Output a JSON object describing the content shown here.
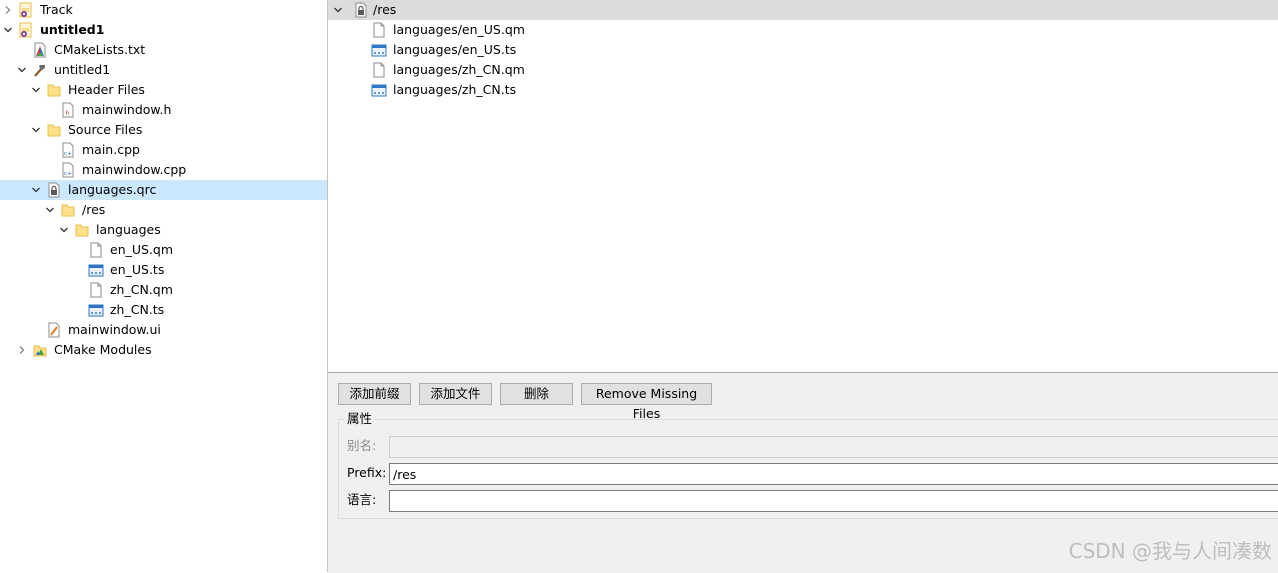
{
  "project_tree": [
    {
      "label": "Track",
      "icon": "qt-project-icon",
      "expand": "collapsed",
      "depth": 0,
      "bold": false
    },
    {
      "label": "untitled1",
      "icon": "qt-project-icon",
      "expand": "expanded",
      "depth": 0,
      "bold": true
    },
    {
      "label": "CMakeLists.txt",
      "icon": "cmake-file-icon",
      "expand": "none",
      "depth": 1,
      "bold": false
    },
    {
      "label": "untitled1",
      "icon": "build-target-icon",
      "expand": "expanded",
      "depth": 1,
      "bold": false
    },
    {
      "label": "Header Files",
      "icon": "folder-icon",
      "expand": "expanded",
      "depth": 2,
      "bold": false
    },
    {
      "label": "mainwindow.h",
      "icon": "header-file-icon",
      "expand": "none",
      "depth": 3,
      "bold": false
    },
    {
      "label": "Source Files",
      "icon": "folder-icon",
      "expand": "expanded",
      "depth": 2,
      "bold": false
    },
    {
      "label": "main.cpp",
      "icon": "cpp-file-icon",
      "expand": "none",
      "depth": 3,
      "bold": false
    },
    {
      "label": "mainwindow.cpp",
      "icon": "cpp-file-icon",
      "expand": "none",
      "depth": 3,
      "bold": false
    },
    {
      "label": "languages.qrc",
      "icon": "qrc-file-icon",
      "expand": "expanded",
      "depth": 2,
      "bold": false,
      "selected": true
    },
    {
      "label": "/res",
      "icon": "folder-icon",
      "expand": "expanded",
      "depth": 3,
      "bold": false
    },
    {
      "label": "languages",
      "icon": "folder-icon",
      "expand": "expanded",
      "depth": 4,
      "bold": false
    },
    {
      "label": "en_US.qm",
      "icon": "blank-file-icon",
      "expand": "none",
      "depth": 5,
      "bold": false
    },
    {
      "label": "en_US.ts",
      "icon": "ts-file-icon",
      "expand": "none",
      "depth": 5,
      "bold": false
    },
    {
      "label": "zh_CN.qm",
      "icon": "blank-file-icon",
      "expand": "none",
      "depth": 5,
      "bold": false
    },
    {
      "label": "zh_CN.ts",
      "icon": "ts-file-icon",
      "expand": "none",
      "depth": 5,
      "bold": false
    },
    {
      "label": "mainwindow.ui",
      "icon": "ui-file-icon",
      "expand": "none",
      "depth": 2,
      "bold": false
    },
    {
      "label": "CMake Modules",
      "icon": "cmake-modules-icon",
      "expand": "collapsed",
      "depth": 1,
      "bold": false
    }
  ],
  "resource_tree": {
    "prefix_label": "/res",
    "files": [
      {
        "label": "languages/en_US.qm",
        "icon": "blank-file-icon"
      },
      {
        "label": "languages/en_US.ts",
        "icon": "ts-file-icon"
      },
      {
        "label": "languages/zh_CN.qm",
        "icon": "blank-file-icon"
      },
      {
        "label": "languages/zh_CN.ts",
        "icon": "ts-file-icon"
      }
    ]
  },
  "toolbar": {
    "add_prefix": "添加前缀",
    "add_files": "添加文件",
    "remove": "删除",
    "remove_missing": "Remove Missing Files"
  },
  "properties": {
    "title": "属性",
    "alias_label": "别名:",
    "alias_value": "",
    "prefix_label": "Prefix:",
    "prefix_value": "/res",
    "language_label": "语言:",
    "language_value": ""
  },
  "watermark": "CSDN @我与人间凑数"
}
